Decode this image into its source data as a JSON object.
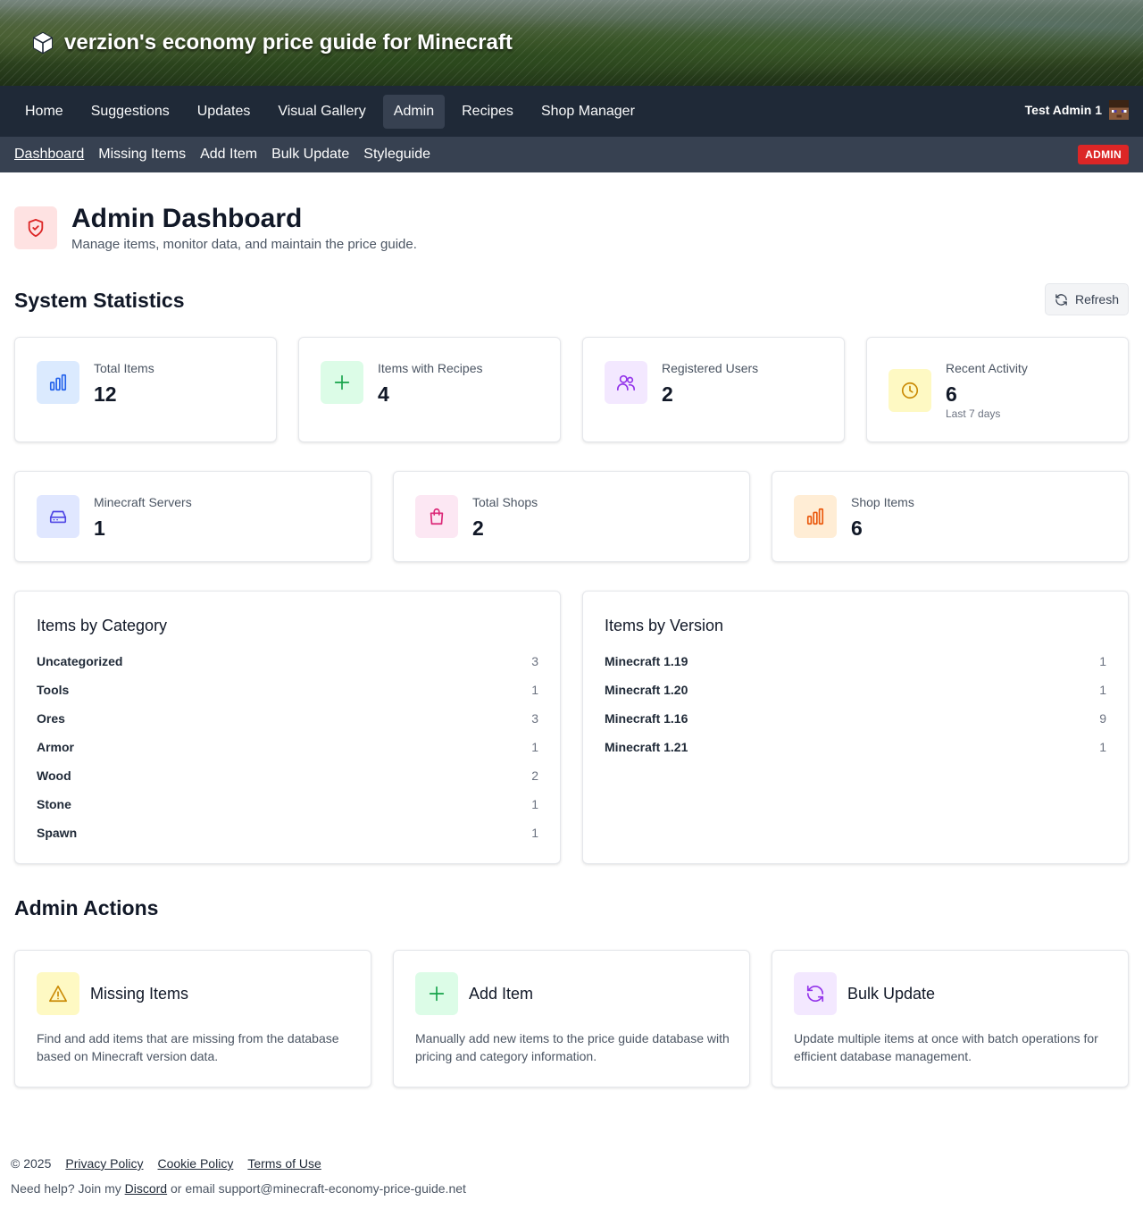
{
  "header": {
    "site_title": "verzion's economy price guide for Minecraft"
  },
  "main_nav": {
    "items": [
      {
        "label": "Home"
      },
      {
        "label": "Suggestions"
      },
      {
        "label": "Updates"
      },
      {
        "label": "Visual Gallery"
      },
      {
        "label": "Admin"
      },
      {
        "label": "Recipes"
      },
      {
        "label": "Shop Manager"
      }
    ],
    "active": "Admin",
    "user_name": "Test Admin 1"
  },
  "sub_nav": {
    "items": [
      {
        "label": "Dashboard"
      },
      {
        "label": "Missing Items"
      },
      {
        "label": "Add Item"
      },
      {
        "label": "Bulk Update"
      },
      {
        "label": "Styleguide"
      }
    ],
    "active": "Dashboard",
    "badge": "ADMIN"
  },
  "page": {
    "title": "Admin Dashboard",
    "subtitle": "Manage items, monitor data, and maintain the price guide."
  },
  "stats_section": {
    "title": "System Statistics",
    "refresh_label": "Refresh",
    "row1": [
      {
        "label": "Total Items",
        "value": "12",
        "icon": "bar-chart-icon",
        "color": "#2563eb",
        "bg": "#dbeafe"
      },
      {
        "label": "Items with Recipes",
        "value": "4",
        "icon": "plus-icon",
        "color": "#16a34a",
        "bg": "#dcfce7"
      },
      {
        "label": "Registered Users",
        "value": "2",
        "icon": "users-icon",
        "color": "#9333ea",
        "bg": "#f3e8ff"
      },
      {
        "label": "Recent Activity",
        "value": "6",
        "note": "Last 7 days",
        "icon": "clock-icon",
        "color": "#ca8a04",
        "bg": "#fef9c3"
      }
    ],
    "row2": [
      {
        "label": "Minecraft Servers",
        "value": "1",
        "icon": "server-icon",
        "color": "#4f46e5",
        "bg": "#e0e7ff"
      },
      {
        "label": "Total Shops",
        "value": "2",
        "icon": "shopping-bag-icon",
        "color": "#db2777",
        "bg": "#fce7f3"
      },
      {
        "label": "Shop Items",
        "value": "6",
        "icon": "bar-chart-icon",
        "color": "#ea580c",
        "bg": "#ffedd5"
      }
    ]
  },
  "category_card": {
    "title": "Items by Category",
    "rows": [
      {
        "name": "Uncategorized",
        "count": "3"
      },
      {
        "name": "Tools",
        "count": "1"
      },
      {
        "name": "Ores",
        "count": "3"
      },
      {
        "name": "Armor",
        "count": "1"
      },
      {
        "name": "Wood",
        "count": "2"
      },
      {
        "name": "Stone",
        "count": "1"
      },
      {
        "name": "Spawn",
        "count": "1"
      }
    ]
  },
  "version_card": {
    "title": "Items by Version",
    "rows": [
      {
        "name": "Minecraft 1.19",
        "count": "1"
      },
      {
        "name": "Minecraft 1.20",
        "count": "1"
      },
      {
        "name": "Minecraft 1.16",
        "count": "9"
      },
      {
        "name": "Minecraft 1.21",
        "count": "1"
      }
    ]
  },
  "actions_section": {
    "title": "Admin Actions",
    "items": [
      {
        "title": "Missing Items",
        "desc": "Find and add items that are missing from the database based on Minecraft version data.",
        "icon": "warning-icon",
        "color": "#ca8a04",
        "bg": "#fef9c3"
      },
      {
        "title": "Add Item",
        "desc": "Manually add new items to the price guide database with pricing and category information.",
        "icon": "plus-icon",
        "color": "#16a34a",
        "bg": "#dcfce7"
      },
      {
        "title": "Bulk Update",
        "desc": "Update multiple items at once with batch operations for efficient database management.",
        "icon": "refresh-icon",
        "color": "#9333ea",
        "bg": "#f3e8ff"
      }
    ]
  },
  "footer": {
    "copyright": "© 2025",
    "links": [
      "Privacy Policy",
      "Cookie Policy",
      "Terms of Use"
    ],
    "help_prefix": "Need help? Join my",
    "discord_label": "Discord",
    "help_suffix": "or email support@minecraft-economy-price-guide.net"
  }
}
